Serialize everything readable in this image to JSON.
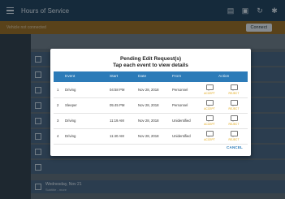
{
  "appbar": {
    "title": "Hours of Service"
  },
  "subbar": {
    "label": "Vehicle not connected",
    "connect_label": "Connect"
  },
  "dialog": {
    "title": "Pending Edit Request(s)",
    "subtitle": "Tap each event to view details",
    "columns": [
      "Event",
      "Start",
      "Date",
      "From",
      "Action"
    ],
    "rows": [
      {
        "num": "1",
        "event": "Driving",
        "start": "04:58 PM",
        "date": "Nov 28, 2018",
        "from": "Personnel",
        "accept": "ACCEPT",
        "reject": "REJECT"
      },
      {
        "num": "2",
        "event": "Sleeper",
        "start": "05:45 PM",
        "date": "Nov 28, 2018",
        "from": "Personnel",
        "accept": "ACCEPT",
        "reject": "REJECT"
      },
      {
        "num": "3",
        "event": "Driving",
        "start": "11:19 AM",
        "date": "Nov 28, 2018",
        "from": "Unidentified",
        "accept": "ACCEPT",
        "reject": "REJECT"
      },
      {
        "num": "4",
        "event": "Driving",
        "start": "11:40 AM",
        "date": "Nov 28, 2018",
        "from": "Unidentified",
        "accept": "ACCEPT",
        "reject": "REJECT"
      }
    ],
    "cancel_label": "CANCEL"
  },
  "background": {
    "bottom_day": "Wednesday, Nov 21",
    "bottom_sub": "Subtitle - more"
  },
  "colors": {
    "appbar": "#1e3f58",
    "subbar": "#9a6b1d",
    "table_header": "#2c7bb8",
    "accent": "#e0a000"
  }
}
